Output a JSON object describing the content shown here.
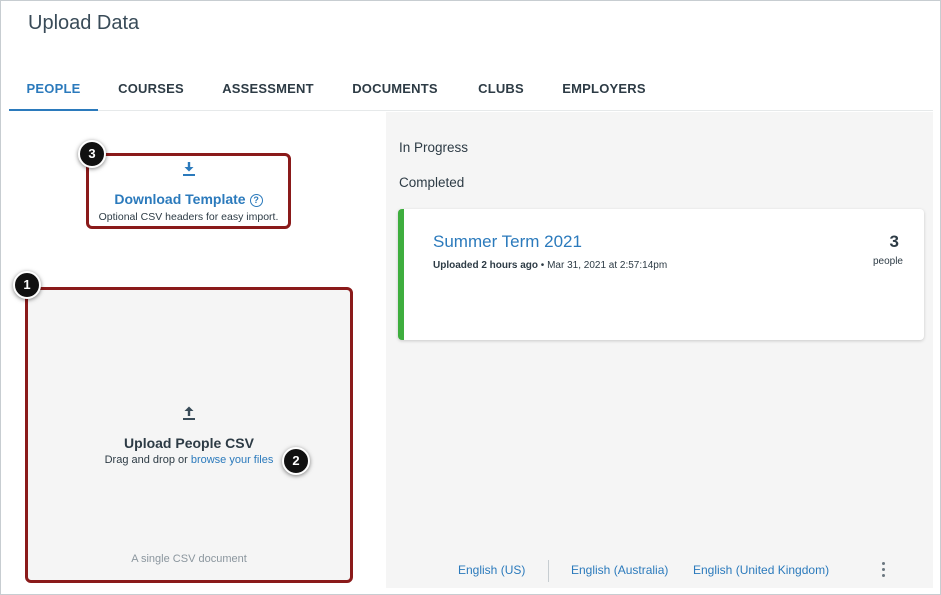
{
  "page": {
    "title": "Upload Data"
  },
  "tabs": [
    {
      "label": "PEOPLE",
      "active": true
    },
    {
      "label": "COURSES",
      "active": false
    },
    {
      "label": "ASSESSMENT",
      "active": false
    },
    {
      "label": "DOCUMENTS",
      "active": false
    },
    {
      "label": "CLUBS",
      "active": false
    },
    {
      "label": "EMPLOYERS",
      "active": false
    }
  ],
  "download": {
    "icon": "download-icon",
    "link_label": "Download Template",
    "help_icon": "help-circle-icon",
    "help_glyph": "?",
    "subtitle": "Optional CSV headers for easy import."
  },
  "upload": {
    "icon": "upload-icon",
    "title": "Upload People CSV",
    "prefix": "Drag and drop or ",
    "browse_link": "browse your files",
    "note": "A single CSV document"
  },
  "callouts": [
    "1",
    "2",
    "3"
  ],
  "status": {
    "in_progress_label": "In Progress",
    "completed_label": "Completed"
  },
  "completed_items": [
    {
      "title": "Summer Term 2021",
      "uploaded_label": "Uploaded 2 hours ago",
      "separator": " • ",
      "timestamp": "Mar 31, 2021 at 2:57:14pm",
      "count": "3",
      "count_label": "people",
      "status_color": "#3eae3e"
    }
  ],
  "languages": [
    "English (US)",
    "English (Australia)",
    "English (United Kingdom)"
  ],
  "colors": {
    "accent": "#2b7abc",
    "callout_border": "#8a1a1a",
    "success": "#3eae3e"
  }
}
